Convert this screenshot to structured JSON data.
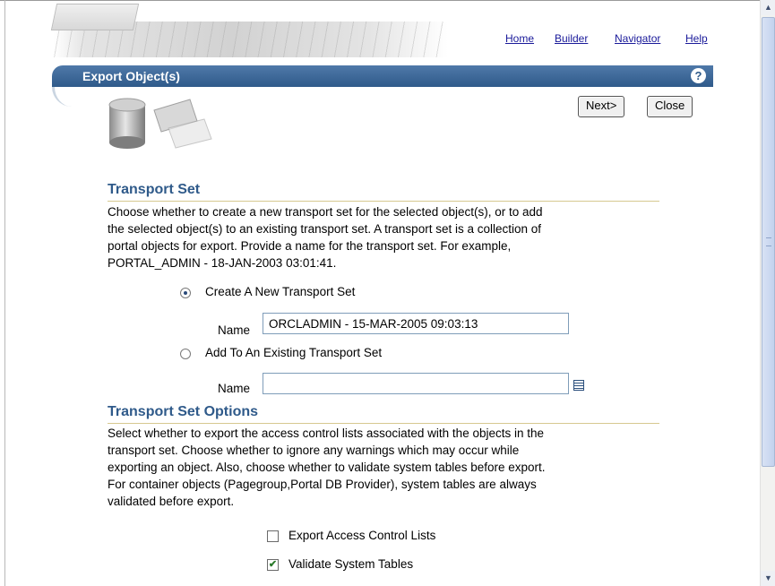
{
  "nav_links": {
    "home": "Home",
    "builder": "Builder",
    "navigator": "Navigator",
    "help": "Help"
  },
  "page_title": "Export Object(s)",
  "help_icon_glyph": "?",
  "buttons": {
    "next": "Next>",
    "close": "Close"
  },
  "transport_set": {
    "title": "Transport Set",
    "description": [
      "Choose whether to create a new transport set for the selected object(s), or to add",
      "the selected object(s) to an existing transport set. A transport set is a collection of",
      "portal objects for export. Provide a name for the transport set. For example,",
      "PORTAL_ADMIN - 18-JAN-2003 03:01:41."
    ],
    "option_new_label": "Create A New Transport Set",
    "option_new_selected": true,
    "name_label": "Name",
    "new_name_value": "ORCLADMIN - 15-MAR-2005 09:03:13",
    "option_existing_label": "Add To An Existing Transport Set",
    "option_existing_selected": false,
    "existing_name_value": ""
  },
  "transport_set_options": {
    "title": "Transport Set Options",
    "description": [
      "Select whether to export the access control lists associated with the objects in the",
      "transport set. Choose whether to ignore any warnings which may occur while",
      "exporting an object. Also, choose whether to validate system tables before export.",
      "For container objects (Pagegroup,Portal DB Provider), system tables are always",
      "validated before export."
    ],
    "export_acl_label": "Export Access Control Lists",
    "export_acl_checked": false,
    "validate_tables_label": "Validate System Tables",
    "validate_tables_checked": true
  },
  "icons": {
    "help": "help-icon",
    "list_of_values": "list-of-values-icon",
    "scroll_up": "scroll-up-arrow-icon",
    "scroll_down": "scroll-down-arrow-icon"
  },
  "colors": {
    "accent_blue": "#2f5a8a",
    "link": "#1a1a9a",
    "section_rule": "#d6c990"
  }
}
